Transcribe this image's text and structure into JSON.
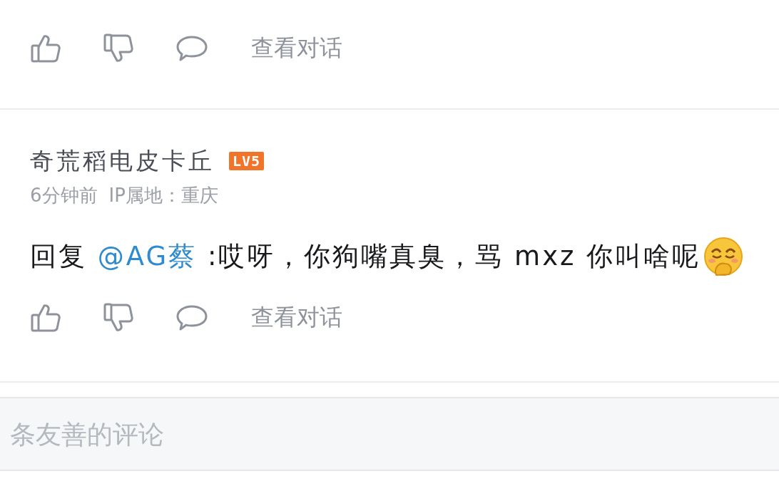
{
  "comments": [
    {
      "view_label": "查看对话"
    },
    {
      "author": "奇荒稻电皮卡丘",
      "level": "LV5",
      "time": "6分钟前",
      "location": "IP属地：重庆",
      "reply_prefix": "回复",
      "mention": "@AG蔡",
      "text": ":哎呀，你狗嘴真臭，骂 mxz 你叫啥呢",
      "emoji": true,
      "view_label": "查看对话"
    }
  ],
  "input": {
    "placeholder": "条友善的评论"
  }
}
